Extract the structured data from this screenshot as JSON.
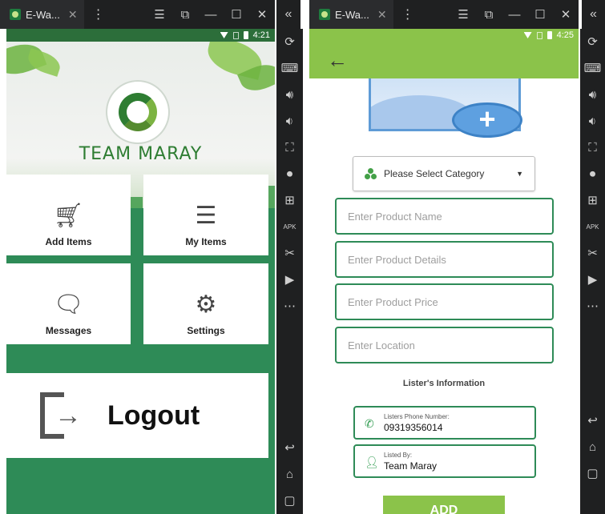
{
  "left_window": {
    "tab_title": "E-Wa...",
    "time": "4:21"
  },
  "right_window": {
    "tab_title": "E-Wa...",
    "time": "4:25"
  },
  "emulator_sidebar_icons": [
    "sync-icon",
    "keyboard-icon",
    "volume-up-icon",
    "volume-down-icon",
    "screenshot-icon",
    "record-icon",
    "add-window-icon",
    "apk-icon",
    "cut-icon",
    "video-icon",
    "more-icon",
    "back-icon",
    "home-icon",
    "recents-icon"
  ],
  "home": {
    "brand": "TEAM MARAY",
    "tiles": [
      {
        "label": "Add Items",
        "icon": "cart-add-icon"
      },
      {
        "label": "My Items",
        "icon": "list-icon"
      },
      {
        "label": "Messages",
        "icon": "message-icon"
      },
      {
        "label": "Settings",
        "icon": "gear-icon"
      }
    ],
    "logout_label": "Logout"
  },
  "add_item": {
    "category_placeholder": "Please Select Category",
    "fields": [
      "Enter Product Name",
      "Enter Product Details",
      "Enter Product Price",
      "Enter Location"
    ],
    "lister_heading": "Lister's Information",
    "phone_label": "Listers Phone Number:",
    "phone_value": "09319356014",
    "listed_by_label": "Listed By:",
    "listed_by_value": "Team Maray",
    "add_button": "ADD"
  },
  "colors": {
    "primary_green": "#2e8b57",
    "appbar_green": "#8bc34a",
    "emulator_dark": "#1f2021"
  }
}
